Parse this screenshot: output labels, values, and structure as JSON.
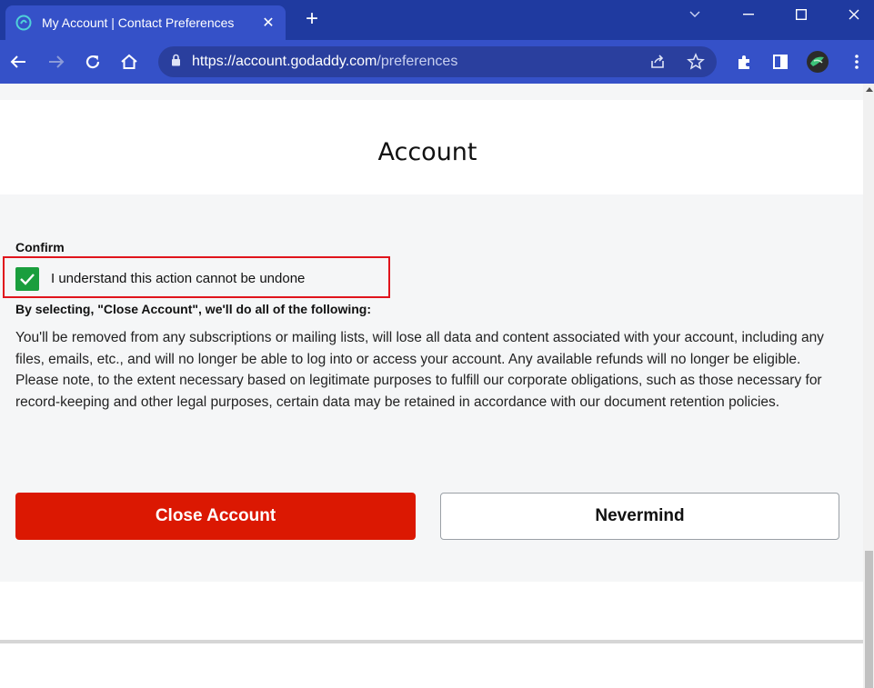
{
  "browser": {
    "tab_title": "My Account | Contact Preferences",
    "url_host": "https://account.godaddy.com",
    "url_path": "/preferences"
  },
  "page": {
    "title": "Account",
    "confirm_label": "Confirm",
    "checkbox_label": "I understand this action cannot be undone",
    "checkbox_checked": true,
    "by_selecting_heading": "By selecting, \"Close Account\", we'll do all of the following:",
    "body_text": "You'll be removed from any subscriptions or mailing lists, will lose all data and content associated with your account, including any files, emails, etc., and will no longer be able to log into or access your account. Any available refunds will no longer be eligible. Please note, to the extent necessary based on legitimate purposes to fulfill our corporate obligations, such as those necessary for record-keeping and other legal purposes, certain data may be retained in accordance with our document retention policies.",
    "close_button": "Close Account",
    "nevermind_button": "Nevermind"
  },
  "colors": {
    "chrome_dark": "#1f3aa0",
    "chrome_tab": "#3551c8",
    "danger_red": "#db1802",
    "check_green": "#1a9e3d",
    "highlight_red": "#e0141c"
  },
  "icons": [
    "godaddy-favicon-icon",
    "close-icon",
    "plus-icon",
    "chevron-down-icon",
    "minimize-icon",
    "maximize-icon",
    "window-close-icon",
    "back-icon",
    "forward-icon",
    "reload-icon",
    "home-icon",
    "lock-icon",
    "share-icon",
    "star-icon",
    "extensions-icon",
    "sidepanel-icon",
    "profile-avatar",
    "kebab-menu-icon",
    "checkmark-icon"
  ]
}
